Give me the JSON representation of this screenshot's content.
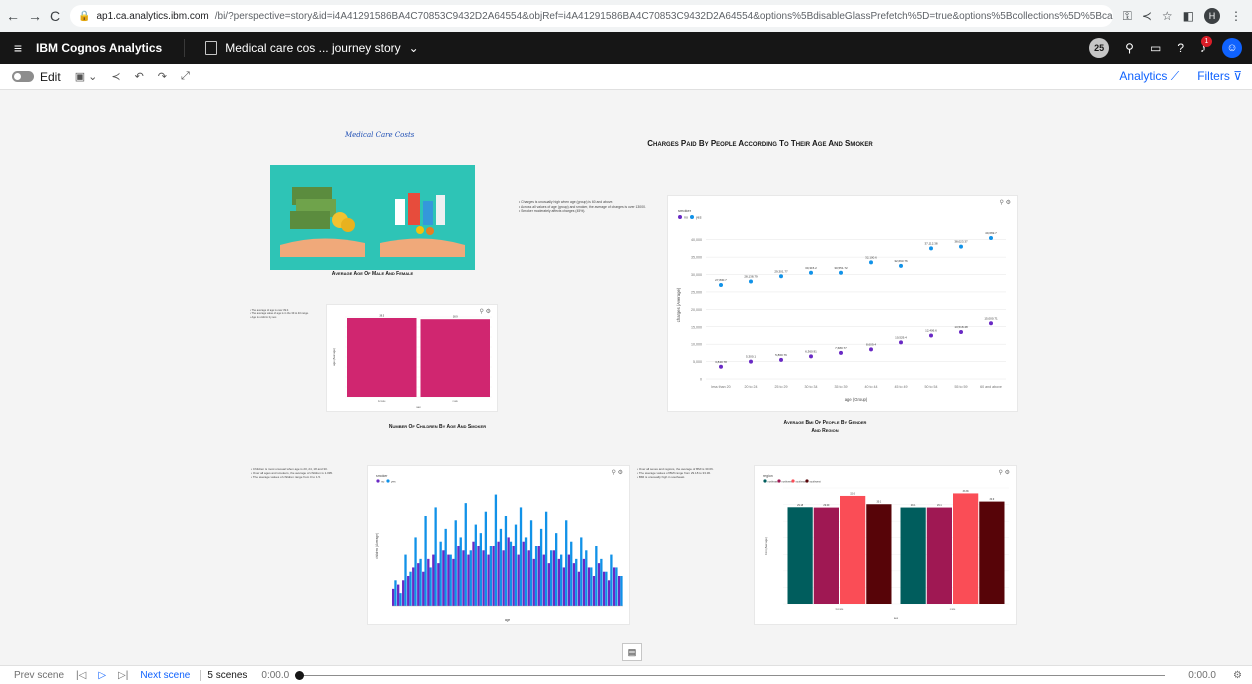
{
  "browser": {
    "url_host": "ap1.ca.analytics.ibm.com",
    "url_rest": "/bi/?perspective=story&id=i4A41291586BA4C70853C9432D2A64554&objRef=i4A41291586BA4C70853C9432D2A64554&options%5BdisableGlassPrefetch%5D=true&options%5Bcollections%5D%5BcanvasExt...",
    "profile_initial": "H"
  },
  "app": {
    "brand": "IBM Cognos Analytics",
    "doc_title": "Medical care cos ... journey story",
    "notif_count": "25",
    "bell_count": "1"
  },
  "toolbar": {
    "edit_label": "Edit",
    "analytics_label": "Analytics",
    "filters_label": "Filters"
  },
  "story": {
    "script_title": "Medical Care Costs",
    "main_title": "Charges Paid By People According To Their Age And Smoker",
    "avg_age_title": "Average Age Of Male And Female",
    "children_title": "Number Of Children By Age And Smoker",
    "bmi_title_1": "Average Bmi Of People By Gender",
    "bmi_title_2": "And Region",
    "notes_main": [
      "Charges is unusually high when age (group) is 60 and above.",
      "Across all values of age (group) and smoker, the average of charges is over 13000.",
      "Smoker moderately affects charges (45%)."
    ],
    "notes_age": [
      "The average of age is over 39.0.",
      "The average value of age is in the 39 to 40 range.",
      "Age is uniform by sex."
    ],
    "notes_children": [
      "Children is most unusual when age is 20, 24, 18 and 30.",
      "Over all ages and smokers, the average of children is 1.095.",
      "The average values of children range from 0 to 1.5."
    ],
    "notes_bmi": [
      "Over all sexes and regions, the average of BMI is 30.66.",
      "The average values of BMI range from 29.18 to 33.36.",
      "BMI is unusually high in southeast."
    ]
  },
  "charts": {
    "scatter": {
      "legend_title": "smoker",
      "legend": [
        "no",
        "yes"
      ],
      "ylabel": "charges (Average)",
      "xlabel": "age (Group)",
      "categories": [
        "less than 20",
        "20 to 24",
        "25 to 29",
        "30 to 34",
        "35 to 39",
        "40 to 44",
        "45 to 49",
        "50 to 54",
        "55 to 59",
        "60 and above"
      ],
      "yticks": [
        "40,000",
        "35,000",
        "30,000",
        "25,000",
        "20,000",
        "15,000",
        "10,000",
        "5,000",
        "0"
      ],
      "series_no": [
        3500,
        5000,
        5500,
        6500,
        7500,
        8500,
        10500,
        12500,
        13500,
        16000
      ],
      "series_yes": [
        27000,
        28000,
        29500,
        30500,
        30500,
        33500,
        32500,
        37500,
        38000,
        40500
      ],
      "labels_no": [
        "3,840.78",
        "5,300.1",
        "5,860.76",
        "6,360.91",
        "7,680.77",
        "8,609.4",
        "10,529.4",
        "12,406.6",
        "13,518.48",
        "15,000.71"
      ],
      "labels_yes": [
        "27,830.7",
        "28,138.79",
        "29,301.77",
        "30,315.2",
        "30,551.72",
        "32,100.6",
        "32,693.76",
        "37,112.38",
        "38,023.37",
        "40,669.7"
      ],
      "color_no": "#6929c4",
      "color_yes": "#1192e8"
    },
    "avg_age_bar": {
      "values": [
        39.5,
        38.9
      ],
      "labels": [
        "39.5",
        "38.9"
      ],
      "categories": [
        "female",
        "male"
      ],
      "ylabel": "age (Average)",
      "xlabel": "sex",
      "color": "#d02670"
    },
    "children_bar": {
      "legend_title": "smoker",
      "legend": [
        "no",
        "yes"
      ],
      "ylabel": "children (Average)",
      "xlabel": "age",
      "color_no": "#6929c4",
      "color_yes": "#1192e8",
      "series_no": [
        0.4,
        0.5,
        0.6,
        0.7,
        0.9,
        1.0,
        0.8,
        1.1,
        1.2,
        1.0,
        1.3,
        1.2,
        1.1,
        1.4,
        1.3,
        1.2,
        1.5,
        1.4,
        1.3,
        1.2,
        1.4,
        1.5,
        1.3,
        1.6,
        1.4,
        1.2,
        1.5,
        1.3,
        1.1,
        1.4,
        1.2,
        1.0,
        1.3,
        1.1,
        0.9,
        1.2,
        1.0,
        0.8,
        1.1,
        0.9,
        0.7,
        1.0,
        0.8,
        0.6,
        0.9,
        0.7
      ],
      "series_yes": [
        0.6,
        0.3,
        1.2,
        0.8,
        1.6,
        1.1,
        2.1,
        0.9,
        2.3,
        1.5,
        1.8,
        1.2,
        2.0,
        1.6,
        2.4,
        1.3,
        1.9,
        1.7,
        2.2,
        1.4,
        2.6,
        1.8,
        2.1,
        1.5,
        1.9,
        2.3,
        1.6,
        2.0,
        1.4,
        1.8,
        2.2,
        1.3,
        1.7,
        1.2,
        2.0,
        1.5,
        1.1,
        1.6,
        1.3,
        0.9,
        1.4,
        1.1,
        0.8,
        1.2,
        0.9,
        0.7
      ]
    },
    "bmi_bar": {
      "legend_title": "region",
      "legend": [
        "northeast",
        "northwest",
        "southeast",
        "southwest"
      ],
      "colors": [
        "#005d5d",
        "#9f1853",
        "#fa4d56",
        "#570408"
      ],
      "groups": [
        "female",
        "male"
      ],
      "values": [
        [
          29.18,
          29.09,
          32.6,
          30.1
        ],
        [
          29.1,
          29.1,
          33.36,
          30.9
        ]
      ],
      "labels": [
        [
          "29.18",
          "29.09",
          "32.6",
          "30.1"
        ],
        [
          "29.1",
          "29.1",
          "33.36",
          "30.9"
        ]
      ],
      "ylabel": "bmi (Average)",
      "xlabel": "sex"
    }
  },
  "bottom": {
    "prev": "Prev scene",
    "next": "Next scene",
    "scenes": "5 scenes",
    "time_start": "0:00.0",
    "time_end": "0:00.0"
  }
}
